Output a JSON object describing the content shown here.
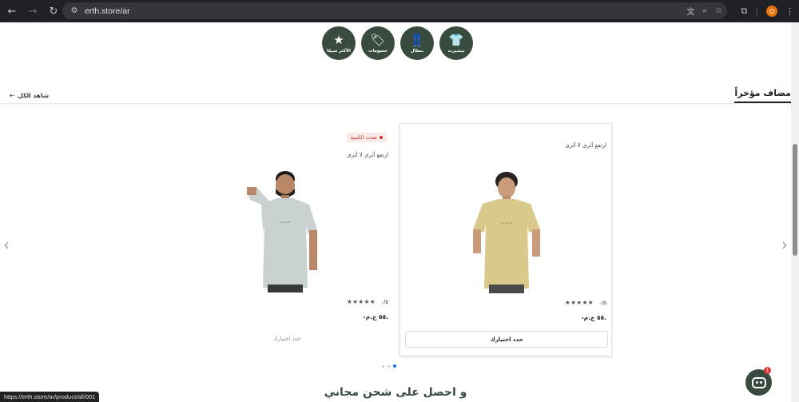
{
  "browser": {
    "url": "erth.store/ar",
    "profile_initial": "O",
    "status_url": "https://erth.store/ar/product/all/001"
  },
  "categories": [
    {
      "label": "تيشيرت",
      "icon": "tshirt-icon",
      "glyph": "👕"
    },
    {
      "label": "بنطال",
      "icon": "pants-icon",
      "glyph": "👖"
    },
    {
      "label": "خصومات",
      "icon": "tag-icon",
      "glyph": "🏷"
    },
    {
      "label": "الأكثر مبيعًا",
      "icon": "star-icon",
      "glyph": "★"
    }
  ],
  "section": {
    "title": "مضاف مؤخراً",
    "view_all": "شاهد الكل"
  },
  "products": [
    {
      "name": "ارتفع أثرى لا أثرى",
      "rating": "٠/٥",
      "stars": "★★★★★",
      "price": "-٥٥ ج.م.",
      "button": "حدد اختيارك",
      "badge": "",
      "shirt_color": "#d9c98a"
    },
    {
      "name": "ارتفع أثرى لا أثرى",
      "rating": "٠/٥",
      "stars": "★★★★★",
      "price": "-٥٥ ج.م.",
      "button": "حدد اختيارك",
      "badge": "نفذت الكمية",
      "shirt_color": "#c9d2d0"
    }
  ],
  "banner": {
    "title": "و احصل على شحن مجاني"
  },
  "chat": {
    "badge": "1"
  },
  "colors": {
    "brand": "#394a3e",
    "badge_red": "#c0392b",
    "active_dot": "#1a73e8"
  }
}
